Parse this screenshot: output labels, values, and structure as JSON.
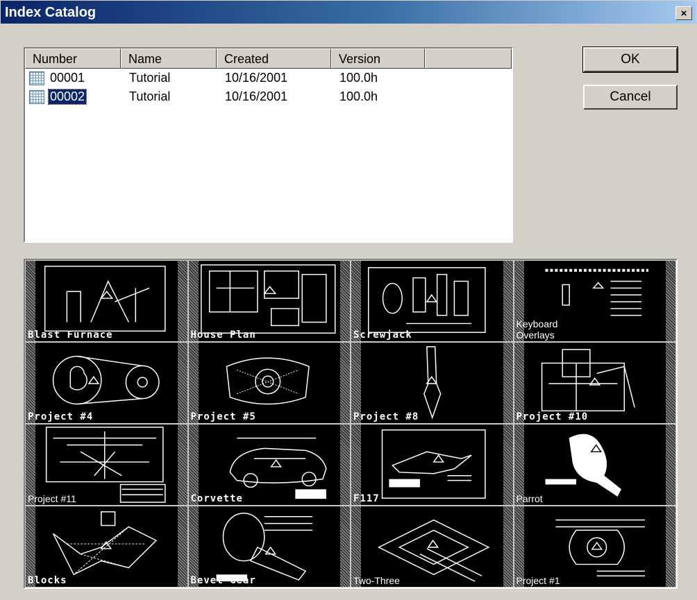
{
  "window": {
    "title": "Index Catalog",
    "close_label": "×"
  },
  "list": {
    "columns": [
      "Number",
      "Name",
      "Created",
      "Version",
      ""
    ],
    "rows": [
      {
        "number": "00001",
        "name": "Tutorial",
        "created": "10/16/2001",
        "version": "100.0h",
        "selected": false
      },
      {
        "number": "00002",
        "name": "Tutorial",
        "created": "10/16/2001",
        "version": "100.0h",
        "selected": true
      }
    ]
  },
  "buttons": {
    "ok": "OK",
    "cancel": "Cancel"
  },
  "thumbnails": [
    {
      "label": "Blast Furnace",
      "icon": "blast-furnace-drawing"
    },
    {
      "label": "House Plan",
      "icon": "house-plan-drawing"
    },
    {
      "label": "Screwjack",
      "icon": "screwjack-drawing"
    },
    {
      "label": "Keyboard\nOverlays",
      "icon": "keyboard-overlays-drawing"
    },
    {
      "label": "Project #4",
      "icon": "belt-pulley-drawing"
    },
    {
      "label": "Project #5",
      "icon": "flange-drawing"
    },
    {
      "label": "Project #8",
      "icon": "blade-drawing"
    },
    {
      "label": "Project #10",
      "icon": "mechanism-drawing"
    },
    {
      "label": "Project #11",
      "icon": "circuit-drawing"
    },
    {
      "label": "Corvette",
      "icon": "car-drawing"
    },
    {
      "label": "F117",
      "icon": "aircraft-drawing"
    },
    {
      "label": "Parrot",
      "icon": "parrot-drawing"
    },
    {
      "label": "Blocks",
      "icon": "blocks-drawing"
    },
    {
      "label": "Bevel Gear",
      "icon": "bevel-gear-drawing"
    },
    {
      "label": "Two-Three",
      "icon": "pipe-drawing"
    },
    {
      "label": "Project #1",
      "icon": "part-drawing"
    }
  ],
  "colors": {
    "titlebar_start": "#0a246a",
    "titlebar_end": "#a6caf0",
    "face": "#d4d0c8",
    "selection": "#0a246a"
  }
}
